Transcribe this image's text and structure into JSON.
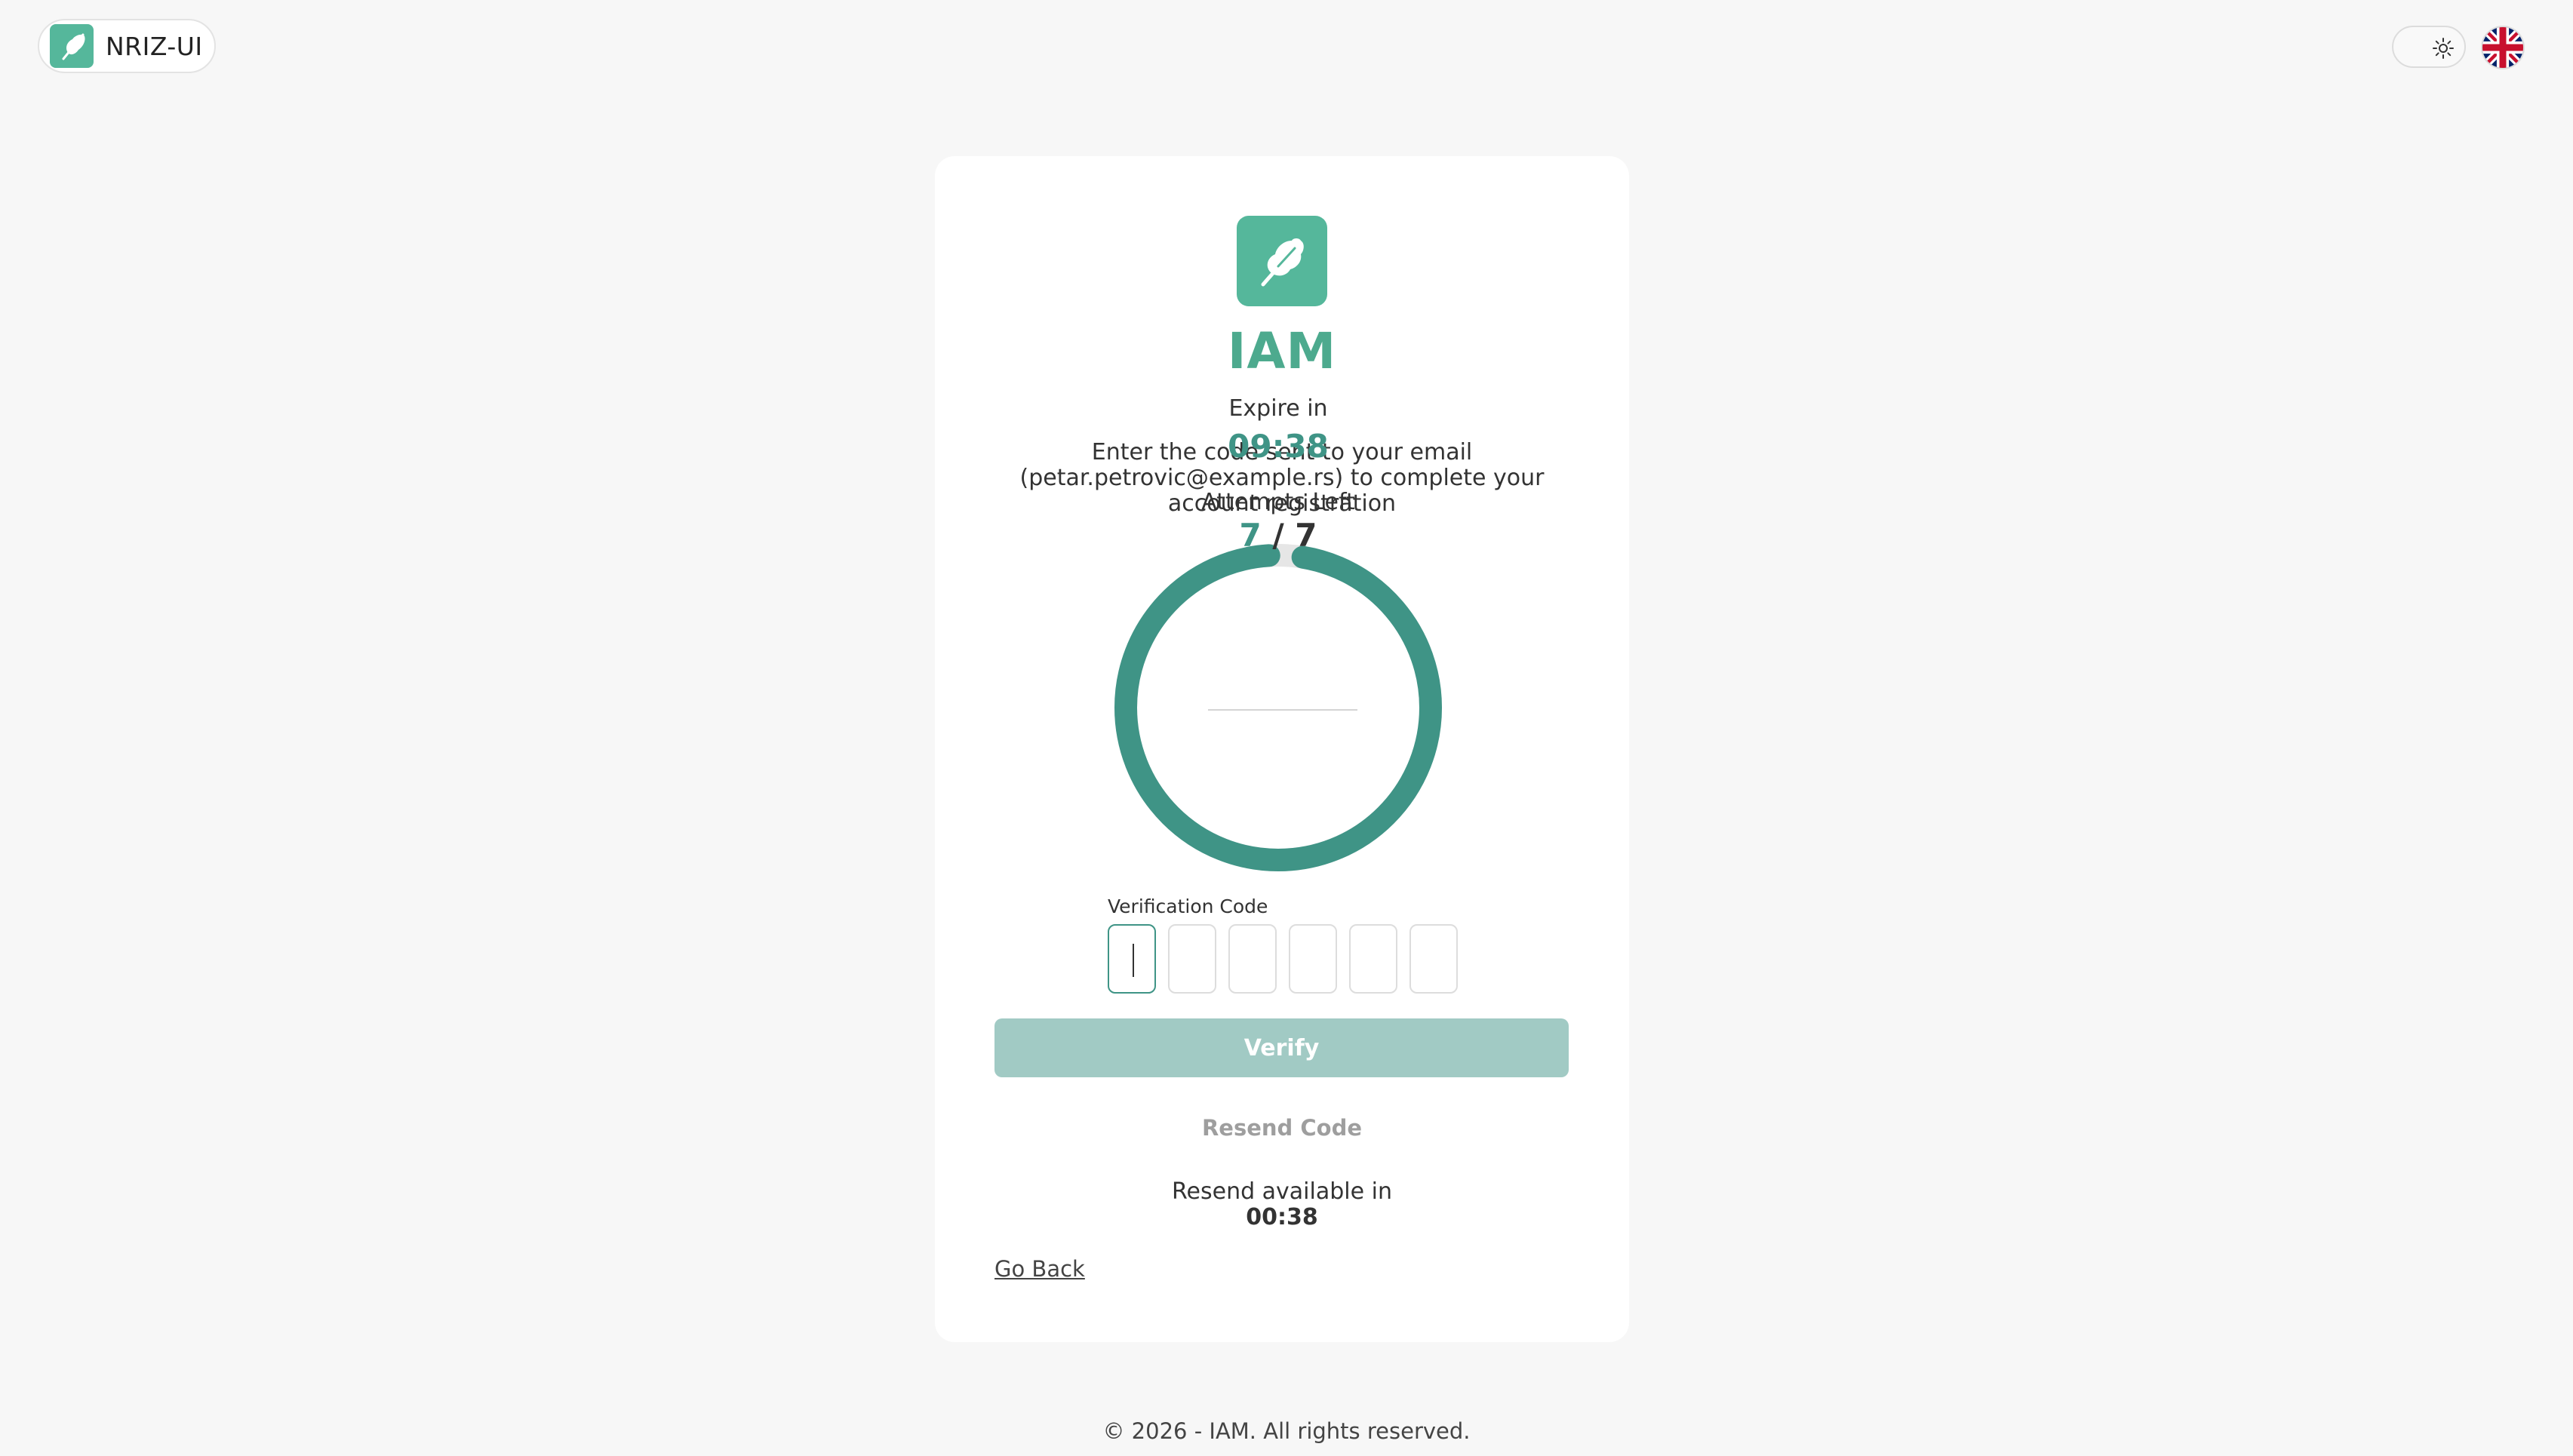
{
  "brand": {
    "name": "NRIZ-UI",
    "logo_icon": "oak-leaf-icon"
  },
  "header": {
    "theme_icon": "sun-icon",
    "language_icon": "uk-flag-icon"
  },
  "app": {
    "title": "IAM",
    "logo_icon": "oak-leaf-icon"
  },
  "instructions": "Enter the code sent to your email (petar.petrovic@example.rs) to complete your account registration",
  "timer": {
    "expire_label": "Expire in",
    "expire_value": "09:38",
    "attempts_label": "Attempts Left",
    "attempts_left": "7",
    "attempts_separator": "/",
    "attempts_total": "7",
    "progress": 0.964
  },
  "verification": {
    "label": "Verification Code",
    "digits": [
      "",
      "",
      "",
      "",
      "",
      ""
    ]
  },
  "actions": {
    "verify_label": "Verify",
    "resend_label": "Resend Code",
    "resend_info": "Resend available in",
    "resend_time": "00:38",
    "go_back": "Go Back"
  },
  "footer": {
    "copyright": "© 2026 - IAM. All rights reserved."
  },
  "colors": {
    "brand_green": "#55b79b",
    "ring_green": "#3f9486",
    "verify_disabled": "#a1cac4"
  }
}
